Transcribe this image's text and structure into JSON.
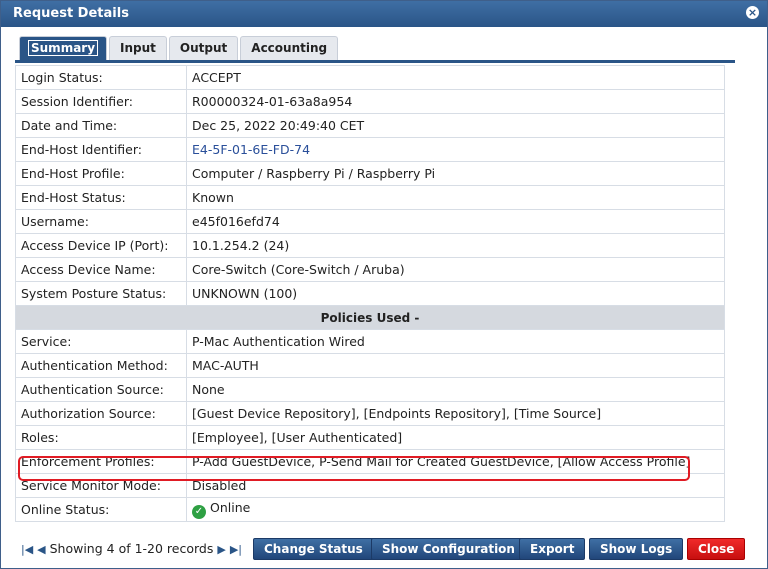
{
  "dialog": {
    "title": "Request Details"
  },
  "tabs": [
    {
      "label": "Summary"
    },
    {
      "label": "Input"
    },
    {
      "label": "Output"
    },
    {
      "label": "Accounting"
    }
  ],
  "rows": [
    {
      "label": "Login Status:",
      "value": "ACCEPT"
    },
    {
      "label": "Session Identifier:",
      "value": "R00000324-01-63a8a954"
    },
    {
      "label": "Date and Time:",
      "value": "Dec 25, 2022 20:49:40 CET"
    },
    {
      "label": "End-Host Identifier:",
      "value": "E4-5F-01-6E-FD-74"
    },
    {
      "label": "End-Host Profile:",
      "value": "Computer / Raspberry Pi / Raspberry Pi"
    },
    {
      "label": "End-Host Status:",
      "value": "Known"
    },
    {
      "label": "Username:",
      "value": "e45f016efd74"
    },
    {
      "label": "Access Device IP (Port):",
      "value": "10.1.254.2 (24)"
    },
    {
      "label": "Access Device Name:",
      "value": "Core-Switch (Core-Switch / Aruba)"
    },
    {
      "label": "System Posture Status:",
      "value": "UNKNOWN (100)"
    }
  ],
  "section_title": "Policies Used -",
  "policy_rows": [
    {
      "label": "Service:",
      "value": "P-Mac Authentication Wired"
    },
    {
      "label": "Authentication Method:",
      "value": "MAC-AUTH"
    },
    {
      "label": "Authentication Source:",
      "value": "None"
    },
    {
      "label": "Authorization Source:",
      "value": "[Guest Device Repository], [Endpoints Repository], [Time Source]"
    },
    {
      "label": "Roles:",
      "value": "[Employee], [User Authenticated]"
    },
    {
      "label": "Enforcement Profiles:",
      "value": "P-Add GuestDevice, P-Send Mail for Created GuestDevice, [Allow Access Profile]"
    },
    {
      "label": "Service Monitor Mode:",
      "value": "Disabled"
    },
    {
      "label": "Online Status:",
      "value": "Online"
    }
  ],
  "footer": {
    "pager_text": "Showing 4 of 1-20 records",
    "buttons": {
      "change_status": "Change Status",
      "show_configuration": "Show Configuration",
      "export": "Export",
      "show_logs": "Show Logs",
      "close": "Close"
    }
  },
  "icons": {
    "online_status": "check-circle-icon"
  },
  "colors": {
    "brand": "#2a5587",
    "highlight": "#e01b24",
    "online": "#2ea043"
  }
}
